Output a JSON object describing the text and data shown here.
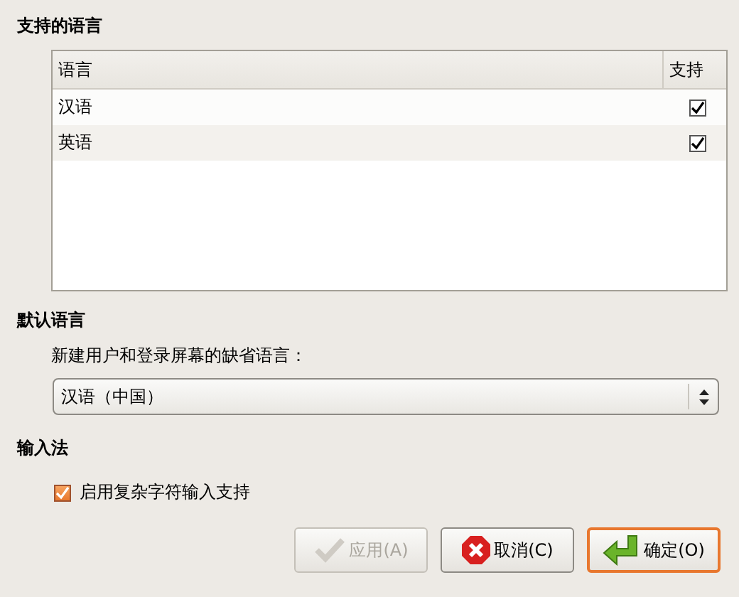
{
  "supported_languages": {
    "heading": "支持的语言",
    "columns": [
      "语言",
      "支持"
    ],
    "rows": [
      {
        "name": "汉语",
        "checked": true
      },
      {
        "name": "英语",
        "checked": true
      }
    ]
  },
  "default_language": {
    "heading": "默认语言",
    "label": "新建用户和登录屏幕的缺省语言：",
    "value": "汉语（中国）"
  },
  "input_method": {
    "heading": "输入法",
    "option": {
      "label": "启用复杂字符输入支持",
      "checked": true
    }
  },
  "buttons": [
    {
      "kind": "apply",
      "label": "应用(A)",
      "disabled": true,
      "focused": false
    },
    {
      "kind": "cancel",
      "label": "取消(C)",
      "disabled": false,
      "focused": false
    },
    {
      "kind": "ok",
      "label": "确定(O)",
      "disabled": false,
      "focused": true
    }
  ]
}
